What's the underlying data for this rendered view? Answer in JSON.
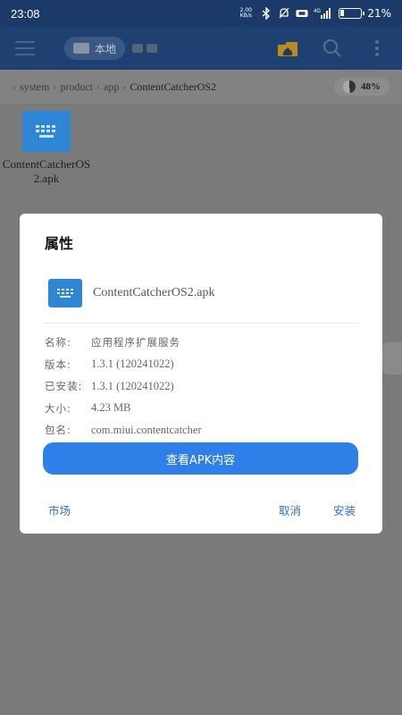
{
  "status_bar": {
    "time": "23:08",
    "net_speed_top": "2.00",
    "net_speed_bottom": "KB/s",
    "network_type": "4G",
    "battery_percent": "21%",
    "battery_level": 0.21
  },
  "toolbar": {
    "location_label": "本地"
  },
  "breadcrumb": {
    "items": [
      "system",
      "product",
      "app",
      "ContentCatcherOS2"
    ],
    "storage_percent": "48%"
  },
  "file_grid": {
    "items": [
      {
        "name": "ContentCatcherOS2.apk"
      }
    ]
  },
  "dialog": {
    "title": "属性",
    "file_name": "ContentCatcherOS2.apk",
    "properties": [
      {
        "key": "名称:",
        "value": "应用程序扩展服务"
      },
      {
        "key": "版本:",
        "value": "1.3.1 (120241022)"
      },
      {
        "key": "已安装:",
        "value": "1.3.1 (120241022)"
      },
      {
        "key": "大小:",
        "value": "4.23 MB"
      },
      {
        "key": "包名:",
        "value": "com.miui.contentcatcher"
      }
    ],
    "primary_button": "查看APK内容",
    "market_label": "市场",
    "cancel_label": "取消",
    "install_label": "安装"
  },
  "colors": {
    "accent": "#2f7fe8",
    "toolbar_bg": "#1f4172",
    "apk_icon": "#2f86d4"
  }
}
